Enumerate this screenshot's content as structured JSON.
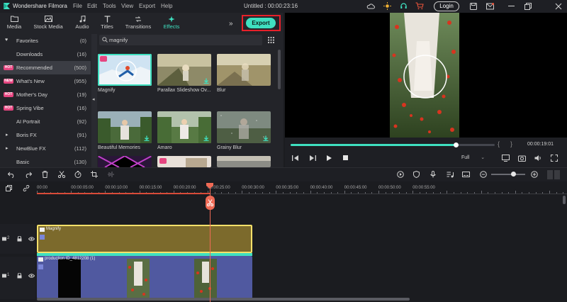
{
  "app": {
    "name": "Wondershare Filmora",
    "doc_title": "Untitled : 00:00:23:16",
    "login": "Login"
  },
  "menu": [
    "File",
    "Edit",
    "Tools",
    "View",
    "Export",
    "Help"
  ],
  "tabs": [
    {
      "label": "Media",
      "icon": "folder-icon"
    },
    {
      "label": "Stock Media",
      "icon": "stock-media-icon"
    },
    {
      "label": "Audio",
      "icon": "music-note-icon"
    },
    {
      "label": "Titles",
      "icon": "titles-icon"
    },
    {
      "label": "Transitions",
      "icon": "transitions-icon"
    },
    {
      "label": "Effects",
      "icon": "effects-icon",
      "active": true
    }
  ],
  "export_label": "Export",
  "categories": [
    {
      "label": "Favorites",
      "count": "(0)",
      "marker": "heart"
    },
    {
      "label": "Downloads",
      "count": "(16)",
      "marker": ""
    },
    {
      "label": "Recommended",
      "count": "(500)",
      "marker": "HOT",
      "selected": true
    },
    {
      "label": "What's New",
      "count": "(955)",
      "marker": "NEW"
    },
    {
      "label": "Mother's Day",
      "count": "(19)",
      "marker": "HOT"
    },
    {
      "label": "Spring Vibe",
      "count": "(16)",
      "marker": "HOT"
    },
    {
      "label": "AI Portrait",
      "count": "(92)",
      "marker": ""
    },
    {
      "label": "Boris FX",
      "count": "(91)",
      "marker": "caret"
    },
    {
      "label": "NewBlue FX",
      "count": "(112)",
      "marker": "caret"
    },
    {
      "label": "Basic",
      "count": "(130)",
      "marker": ""
    }
  ],
  "search": {
    "value": "magnify"
  },
  "effects": [
    {
      "name": "Magnify",
      "selected": true,
      "download": false
    },
    {
      "name": "Parallax Slideshow Ov...",
      "selected": false,
      "download": true
    },
    {
      "name": "Blur",
      "selected": false,
      "download": false
    },
    {
      "name": "Beautiful Memories",
      "selected": false,
      "download": true
    },
    {
      "name": "Amaro",
      "selected": false,
      "download": true
    },
    {
      "name": "Grainy Blur",
      "selected": false,
      "download": true
    },
    {
      "name": "",
      "selected": false,
      "download": false
    },
    {
      "name": "",
      "selected": false,
      "download": false
    },
    {
      "name": "",
      "selected": false,
      "download": false
    }
  ],
  "player": {
    "quality": "Full",
    "timecode": "00:00:19:01",
    "progress": 0.81
  },
  "ruler": [
    "00:00",
    "00:00:05:00",
    "00:00:10:00",
    "00:00:15:00",
    "00:00:20:00",
    "00:00:25:00",
    "00:00:30:00",
    "00:00:35:00",
    "00:00:40:00",
    "00:00:45:00",
    "00:00:50:00",
    "00:00:55:00"
  ],
  "tracks": [
    {
      "index": "2",
      "clip": "Magnify"
    },
    {
      "index": "1",
      "clip": "production ID_4812208 (1)"
    }
  ],
  "colors": {
    "accent": "#3fe0c0",
    "export_highlight": "#e8202a",
    "playhead": "#f06a55",
    "effect_clip": "#7c6a2c",
    "video_clip": "#5059a0"
  }
}
